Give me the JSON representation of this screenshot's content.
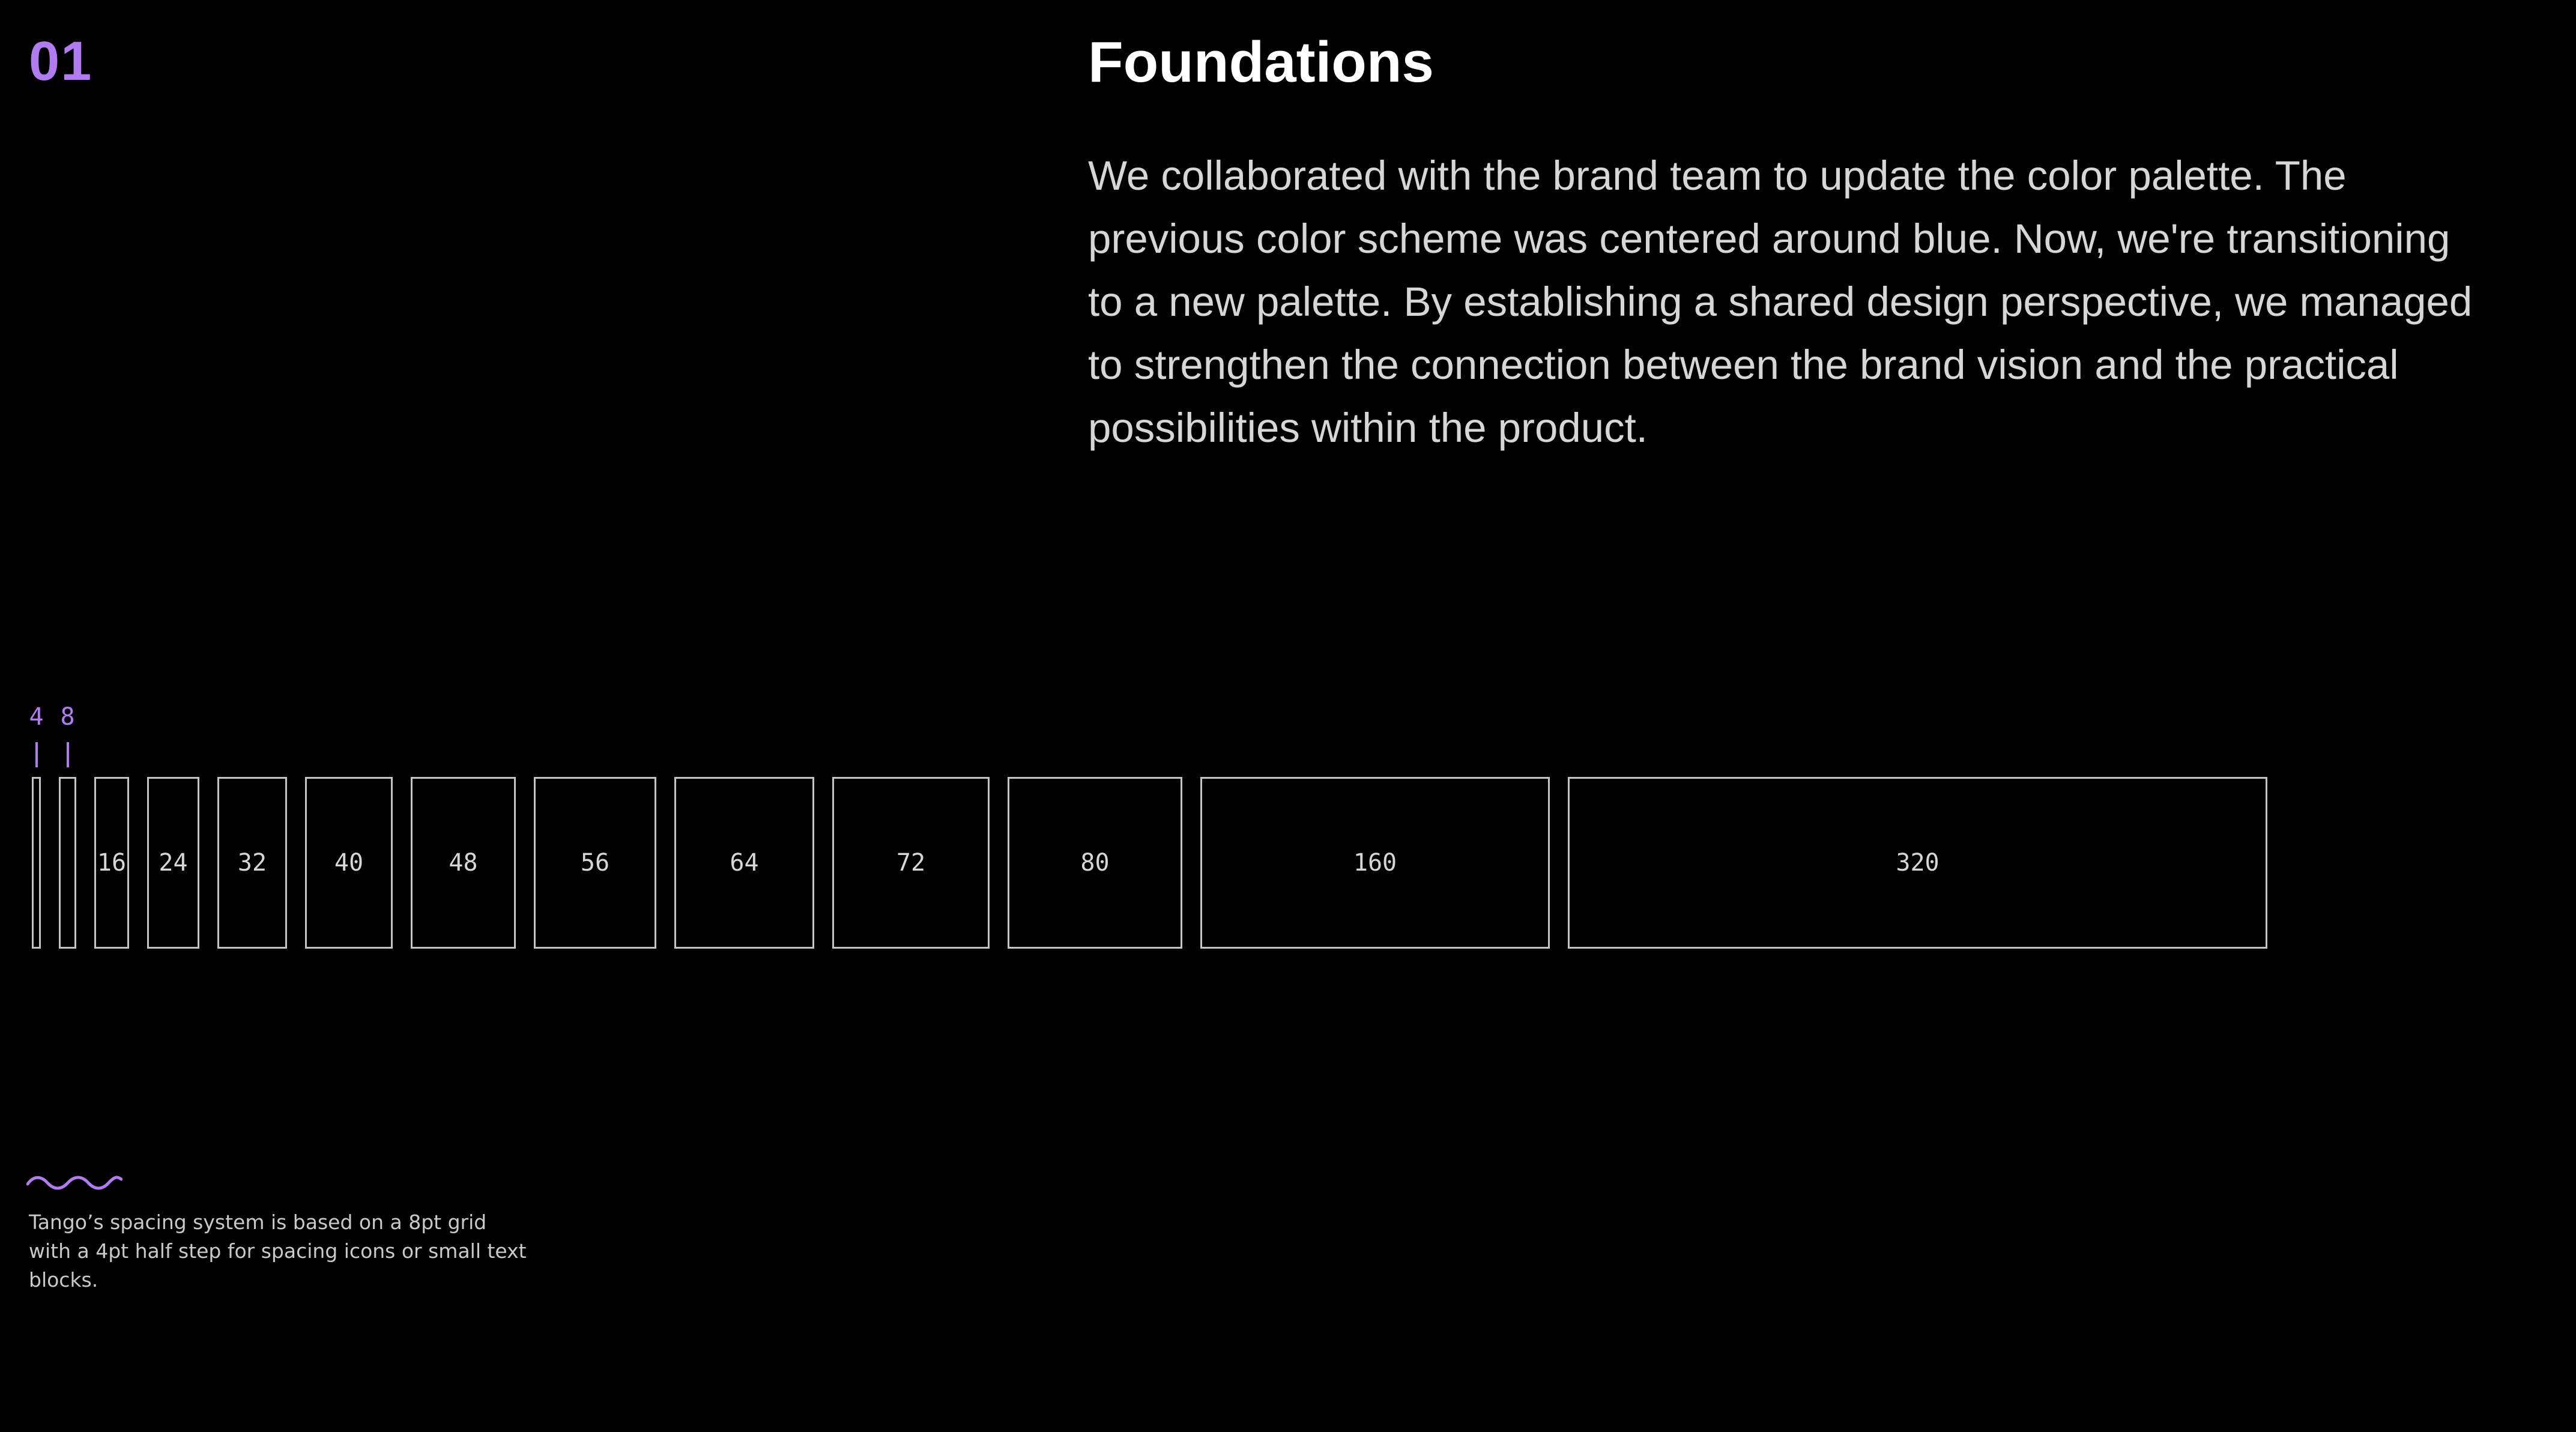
{
  "section_number": "01",
  "title": "Foundations",
  "body": "We collaborated with the brand team to update the color palette. The previous color scheme was centered around blue. Now, we're transitioning to a new palette. By establishing a shared design perspective, we managed to strengthen the connection between the brand vision and the practical possibilities within the product.",
  "caption": "Tango’s spacing system is based on a 8pt grid with a 4pt half step for spacing icons or small text blocks.",
  "colors": {
    "accent": "#b07cf0",
    "background": "#000000",
    "box_border": "#c4c4c4",
    "text": "#d6d6d6"
  },
  "icons": {
    "caption_mark": "wave-squiggle-icon"
  },
  "spacing_scale": {
    "unit": "pt",
    "steps": [
      {
        "value": 4,
        "label": "4"
      },
      {
        "value": 8,
        "label": "8"
      },
      {
        "value": 16,
        "label": "16"
      },
      {
        "value": 24,
        "label": "24"
      },
      {
        "value": 32,
        "label": "32"
      },
      {
        "value": 40,
        "label": "40"
      },
      {
        "value": 48,
        "label": "48"
      },
      {
        "value": 56,
        "label": "56"
      },
      {
        "value": 64,
        "label": "64"
      },
      {
        "value": 72,
        "label": "72"
      },
      {
        "value": 80,
        "label": "80"
      },
      {
        "value": 160,
        "label": "160"
      },
      {
        "value": 320,
        "label": "320"
      }
    ]
  }
}
